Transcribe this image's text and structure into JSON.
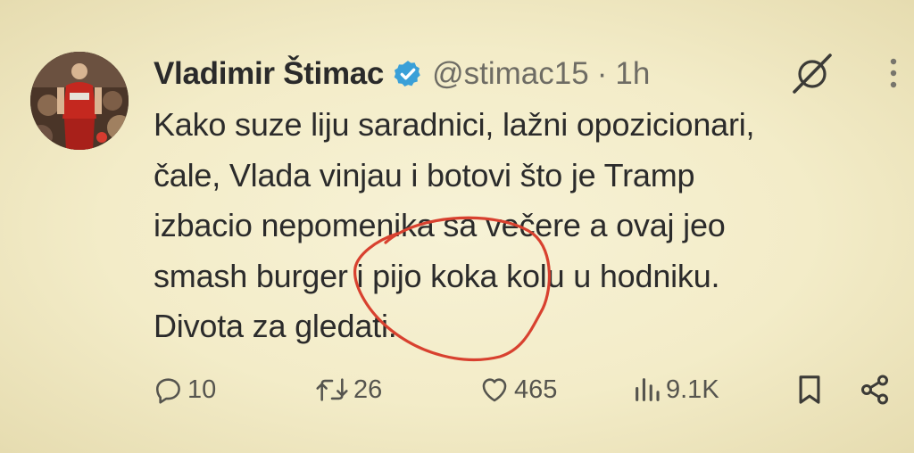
{
  "user": {
    "display_name": "Vladimir Štimac",
    "handle": "@stimac15",
    "separator": "·",
    "time": "1h",
    "verified_icon": "verified-badge-icon",
    "verified_color": "#3aa0d8"
  },
  "tweet": {
    "lines": [
      "Kako suze liju saradnici, lažni opozicionari,",
      "čale, Vlada vinjau i botovi što je Tramp",
      "izbacio nepomenika sa večere a ovaj jeo",
      "smash burger i pijo koka kolu u hodniku.",
      "Divota za gledati."
    ]
  },
  "annotation": {
    "type": "hand-drawn red circle",
    "color": "#d8412f"
  },
  "actions": {
    "reply": {
      "icon": "reply-icon",
      "count": "10"
    },
    "retweet": {
      "icon": "retweet-icon",
      "count": "26"
    },
    "like": {
      "icon": "heart-icon",
      "count": "465"
    },
    "views": {
      "icon": "views-chart-icon",
      "count": "9.1K"
    },
    "bookmark": {
      "icon": "bookmark-icon"
    },
    "share": {
      "icon": "share-icon"
    }
  },
  "toolbar": {
    "grok_icon": "grok-icon",
    "more_icon": "more-vertical-icon"
  },
  "colors": {
    "background": "#f3ecc8",
    "text": "#2b2b2b",
    "muted": "#6e6c64"
  }
}
